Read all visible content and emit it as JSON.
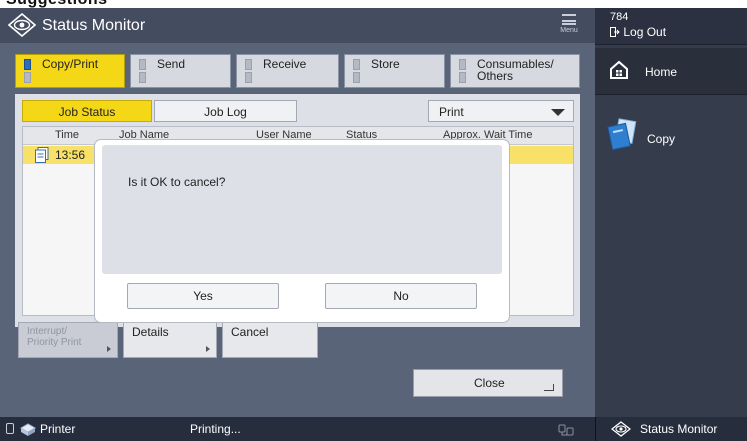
{
  "app": {
    "top_cut_text": "Suggestions",
    "title": "Status Monitor",
    "menu_label": "Menu"
  },
  "tabs": [
    {
      "label": "Copy/Print",
      "active": true
    },
    {
      "label": "Send",
      "active": false
    },
    {
      "label": "Receive",
      "active": false
    },
    {
      "label": "Store",
      "active": false
    },
    {
      "label": "Consumables/\nOthers",
      "active": false
    }
  ],
  "view": {
    "job_status_label": "Job Status",
    "job_log_label": "Job Log",
    "print_select_value": "Print"
  },
  "table": {
    "columns": [
      "Time",
      "Job Name",
      "User Name",
      "Status",
      "Approx. Wait Time"
    ],
    "rows": [
      {
        "time": "13:56",
        "selected": true
      }
    ]
  },
  "actions": {
    "interrupt_label": "Interrupt/\nPriority Print",
    "details_label": "Details",
    "cancel_label": "Cancel",
    "close_label": "Close"
  },
  "dialog": {
    "message": "Is it OK to cancel?",
    "yes_label": "Yes",
    "no_label": "No"
  },
  "sidebar": {
    "user_id": "784",
    "logout_label": "Log Out",
    "home_label": "Home",
    "copy_label": "Copy"
  },
  "statusbar": {
    "device_label": "Printer",
    "status_text": "Printing...",
    "status_monitor_label": "Status Monitor"
  },
  "colors": {
    "accent_yellow": "#f4d817",
    "panel_dark": "#353c4c",
    "main_bg": "#5a6478"
  }
}
